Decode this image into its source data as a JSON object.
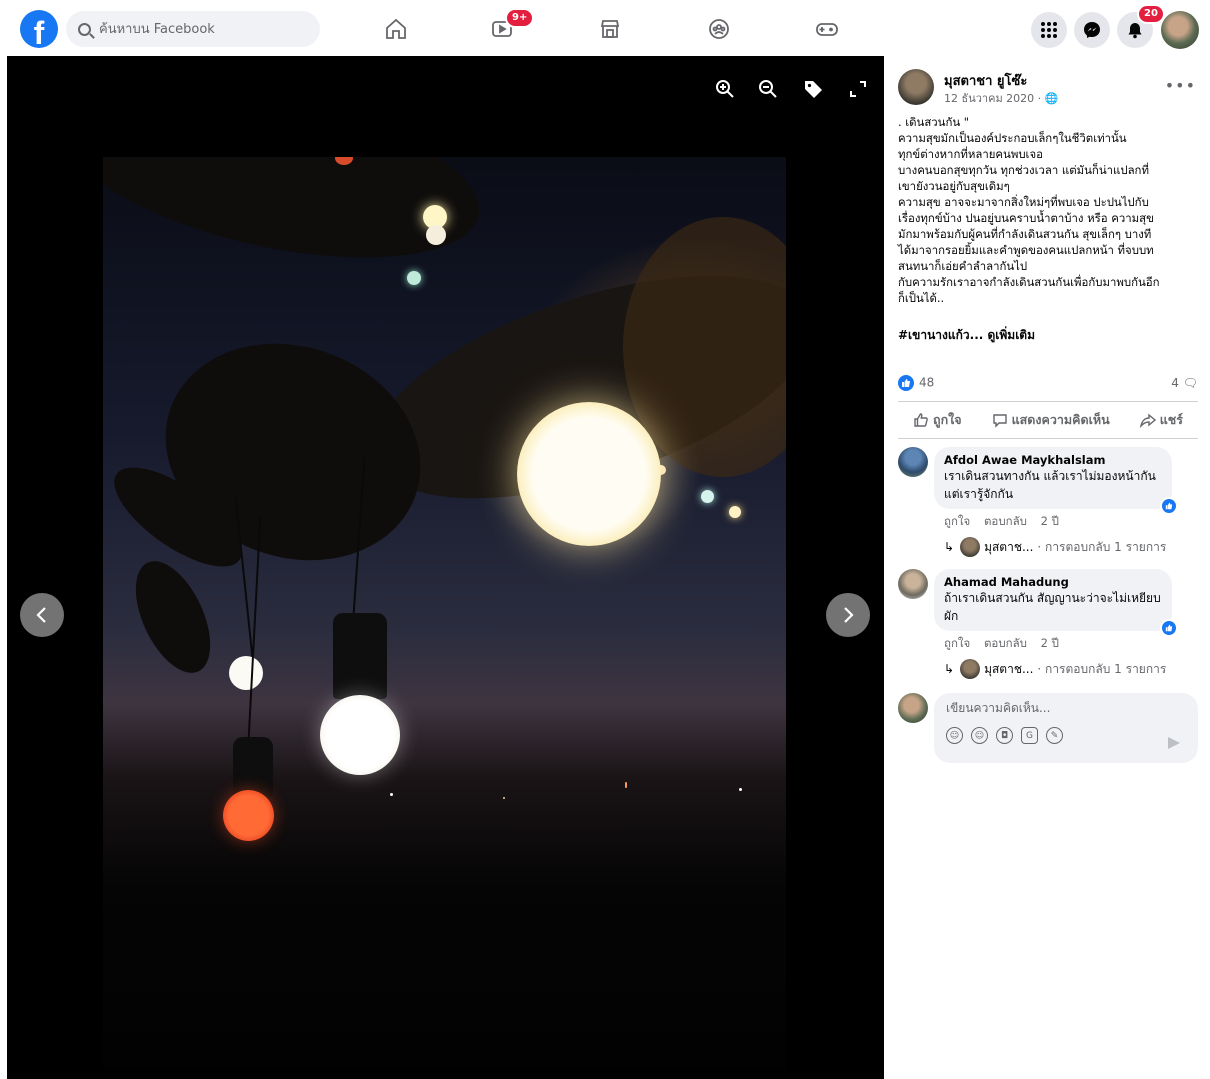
{
  "topbar": {
    "search_placeholder": "ค้นหาบน Facebook",
    "watch_badge": "9+",
    "notifications_badge": "20",
    "icons": [
      "facebook-logo",
      "search-icon",
      "home-icon",
      "watch-icon",
      "marketplace-icon",
      "groups-icon",
      "gaming-icon",
      "menu-grid-icon",
      "messenger-icon",
      "bell-icon"
    ]
  },
  "viewer": {
    "tools": [
      "zoom-in-icon",
      "zoom-out-icon",
      "tag-icon",
      "expand-icon"
    ]
  },
  "post": {
    "author": "มุสตาชา ยูโซ๊ะ",
    "date": "12 ธันวาคม 2020 · ",
    "text": ". เดินสวนกัน \"\nความสุขมักเป็นองค์ประกอบเล็กๆในชีวิตเท่านั้น\nทุกข์ต่างหากที่หลายคนพบเจอ\nบางคนบอกสุขทุกวัน ทุกช่วงเวลา แต่มันก็น่าแปลกที่\nเขายังวนอยู่กับสุขเดิมๆ\nความสุข อาจจะมาจากสิ่งใหม่ๆที่พบเจอ ปะปนไปกับ\nเรื่องทุกข์บ้าง ปนอยู่บนคราบน้ำตาบ้าง หรือ ความสุข\nมักมาพร้อมกับผู้คนที่กำลังเดินสวนกัน สุขเล็กๆ บางที\nได้มาจากรอยยิ้มและคำพูดของคนแปลกหน้า ที่จบบท\nสนทนาก็เอ่ยคำลำลากันไป\nกับความรักเราอาจกำลังเดินสวนกันเพื่อกับมาพบกันอีก\nก็เป็นได้..",
    "tag_line": "#เขานางแก้ว... ดูเพิ่มเติม",
    "like_count": "48",
    "comment_count": "4",
    "actions": {
      "like": "ถูกใจ",
      "comment": "แสดงความคิดเห็น",
      "share": "แชร์"
    }
  },
  "comments": [
    {
      "name": "Afdol Awae Maykhalslam",
      "text": "เราเดินสวนทางกัน แล้วเราไม่มองหน้ากัน แต่เรารู้จักกัน",
      "like_label": "ถูกใจ",
      "reply_label": "ตอบกลับ",
      "time": "2 ปี",
      "reply_author": "มุสตาช...",
      "reply_count": "· การตอบกลับ 1 รายการ"
    },
    {
      "name": "Ahamad Mahadung",
      "text": "ถ้าเราเดินสวนกัน สัญญานะว่าจะไม่เหยียบผัก",
      "like_label": "ถูกใจ",
      "reply_label": "ตอบกลับ",
      "time": "2 ปี",
      "reply_author": "มุสตาช...",
      "reply_count": "· การตอบกลับ 1 รายการ"
    }
  ],
  "composer": {
    "placeholder": "เขียนความคิดเห็น..."
  },
  "colors": {
    "brand": "#1877f2",
    "badge": "#e41e3f",
    "viewer_bg": "#000000"
  }
}
